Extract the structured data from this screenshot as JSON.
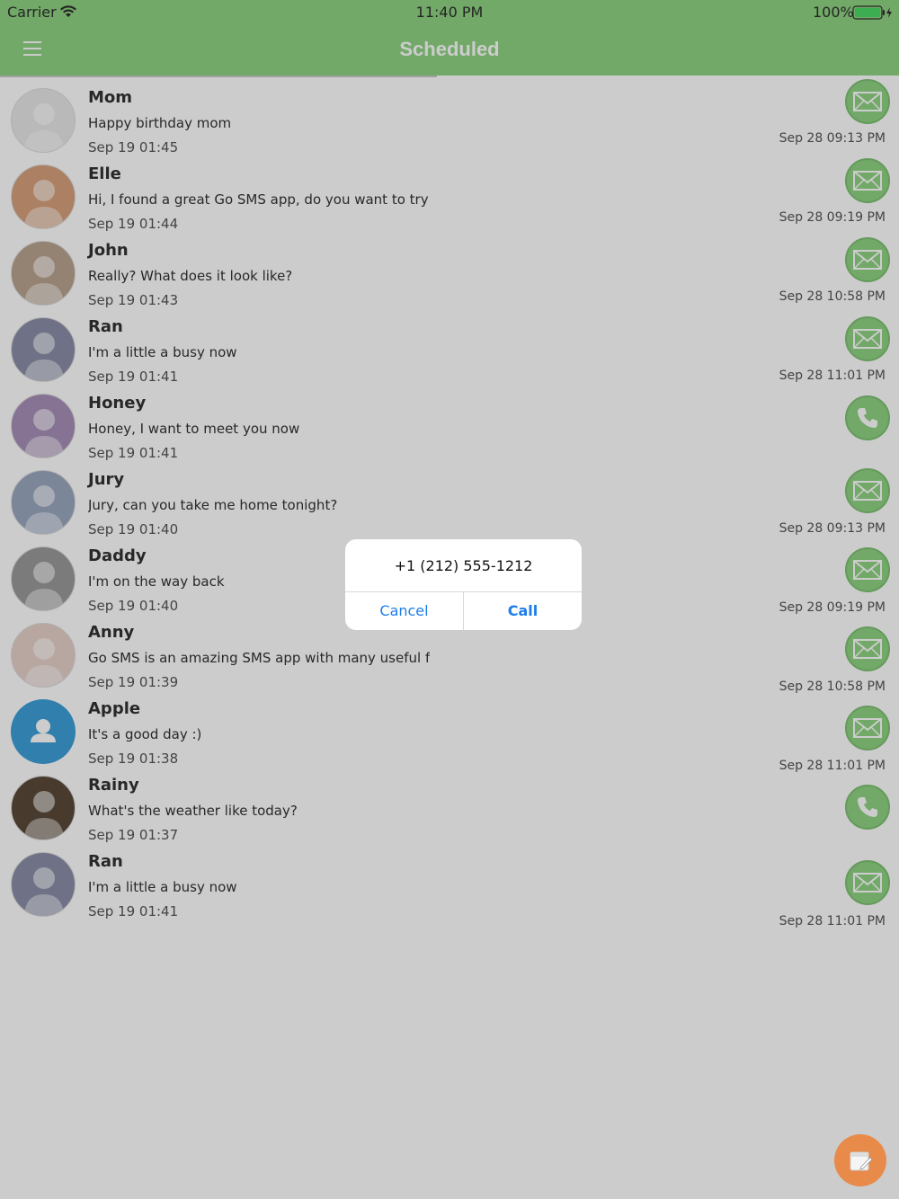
{
  "status_bar": {
    "carrier": "Carrier",
    "time": "11:40 PM",
    "battery": "100%"
  },
  "nav": {
    "title": "Scheduled"
  },
  "rows": [
    {
      "name": "Mom",
      "message": "Happy birthday mom",
      "time": "Sep 19 01:45",
      "scheduled": "Sep 28 09:13 PM",
      "action": "mail"
    },
    {
      "name": "Elle",
      "message": "Hi, I found a great Go SMS app, do you want to try it?",
      "time": "Sep 19 01:44",
      "scheduled": "Sep 28 09:19 PM",
      "action": "mail"
    },
    {
      "name": "John",
      "message": "Really? What does it look like?",
      "time": "Sep 19 01:43",
      "scheduled": "Sep 28 10:58 PM",
      "action": "mail"
    },
    {
      "name": "Ran",
      "message": "I'm a little a busy now",
      "time": "Sep 19 01:41",
      "scheduled": "Sep 28 11:01 PM",
      "action": "mail"
    },
    {
      "name": "Honey",
      "message": "Honey, I want to meet you now",
      "time": "Sep 19 01:41",
      "scheduled": "",
      "action": "phone"
    },
    {
      "name": "Jury",
      "message": "Jury, can you take me home tonight?",
      "time": "Sep 19 01:40",
      "scheduled": "Sep 28 09:13 PM",
      "action": "mail"
    },
    {
      "name": "Daddy",
      "message": "I'm on the way back",
      "time": "Sep 19 01:40",
      "scheduled": "Sep 28 09:19 PM",
      "action": "mail"
    },
    {
      "name": "Anny",
      "message": "Go SMS is an amazing SMS app with many useful features",
      "time": "Sep 19 01:39",
      "scheduled": "Sep 28 10:58 PM",
      "action": "mail"
    },
    {
      "name": "Apple",
      "message": "It's a good day :)",
      "time": "Sep 19 01:38",
      "scheduled": "Sep 28 11:01 PM",
      "action": "mail"
    },
    {
      "name": "Rainy",
      "message": "What's the weather like today?",
      "time": "Sep 19 01:37",
      "scheduled": "",
      "action": "phone"
    },
    {
      "name": "Ran",
      "message": "I'm a little a busy now",
      "time": "Sep 19 01:41",
      "scheduled": "Sep 28 11:01 PM",
      "action": "mail"
    }
  ],
  "dialog": {
    "phone": "+1 (212) 555-1212",
    "cancel_label": "Cancel",
    "call_label": "Call"
  },
  "colors": {
    "accent": "#8fd482",
    "fab": "#e88a4a",
    "link": "#1e7de8"
  }
}
